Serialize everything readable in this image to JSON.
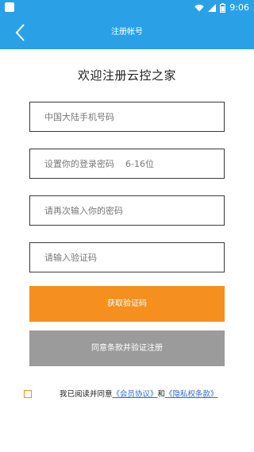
{
  "status_bar": {
    "time": "9:06",
    "icons": [
      "app-icon",
      "wifi-icon",
      "signal-icon",
      "battery-icon"
    ]
  },
  "header": {
    "title": "注册帐号",
    "back_icon": "chevron-left-icon"
  },
  "main": {
    "welcome": "欢迎注册云控之家",
    "phone_placeholder": "中国大陆手机号码",
    "password_placeholder": "设置你的登录密码    6-16位",
    "confirm_placeholder": "请再次输入你的密码",
    "code_placeholder": "请输入验证码",
    "get_code_label": "获取验证码",
    "register_label": "同意条款并验证注册"
  },
  "agreement": {
    "prefix": "我已阅读并同意",
    "member_link": "《会员协议》",
    "and": "和",
    "privacy_link": "《隐私权条款》"
  },
  "colors": {
    "primary": "#2aa1e6",
    "accent": "#f5901e",
    "disabled": "#9b9b9b",
    "link": "#2a6fd6"
  }
}
